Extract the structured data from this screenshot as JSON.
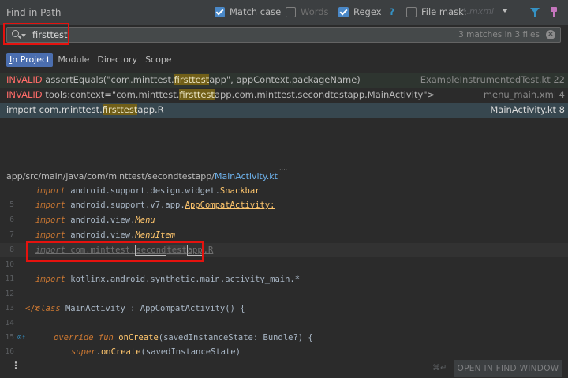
{
  "header": {
    "title": "Find in Path",
    "options": {
      "match_case": {
        "label": "Match case",
        "checked": true
      },
      "words": {
        "label": "Words",
        "checked": false
      },
      "regex": {
        "label": "Regex",
        "help": "?",
        "checked": true
      },
      "file_mask": {
        "label": "File mask:",
        "checked": false,
        "placeholder": "*.mxml"
      }
    }
  },
  "search": {
    "query": "firsttest",
    "match_count": "3 matches in 3 files",
    "clear": "×"
  },
  "scopes": [
    {
      "label": "In Project",
      "active": true
    },
    {
      "label": "Module",
      "active": false
    },
    {
      "label": "Directory",
      "active": false
    },
    {
      "label": "Scope",
      "active": false
    }
  ],
  "results": [
    {
      "prefix": "INVALID",
      "before": " assertEquals(\"com.minttest.",
      "match": "firsttest",
      "after": "app\", appContext.packageName)",
      "file": "ExampleInstrumentedTest.kt 22"
    },
    {
      "prefix": "INVALID",
      "before": " tools:context=\"com.minttest.",
      "match": "firsttest",
      "after": "app.com.minttest.secondtestapp.MainActivity\">",
      "file": "menu_main.xml 4"
    },
    {
      "prefix": "",
      "before": "import com.minttest.",
      "match": "firsttest",
      "after": "app.R",
      "file": "MainActivity.kt 8"
    }
  ],
  "splitter": "....",
  "preview": {
    "path": "app/src/main/java/com/minttest/secondtestapp/",
    "file": "MainActivity.kt",
    "lines": [
      {
        "num": "",
        "kw": "import",
        "rest": " android.support.design.widget.",
        "cls": "Snackbar"
      },
      {
        "num": "5",
        "kw": "import",
        "rest": " android.support.v7.app.",
        "cls": "AppCompatActivity;"
      },
      {
        "num": "6",
        "kw": "import",
        "rest": " android.view.",
        "cls": "Menu"
      },
      {
        "num": "7",
        "kw": "import",
        "rest": " android.view.",
        "cls": "MenuItem"
      },
      {
        "num": "8",
        "kw": "import",
        "rest": " com.minttest.",
        "occ1": "second",
        "occ2": "test",
        "tail": "app",
        "end": ".R"
      },
      {
        "num": "10",
        "text": ""
      },
      {
        "num": "11",
        "kw": "import",
        "rest": " kotlinx.android.synthetic.main.activity_main.*"
      },
      {
        "num": "12",
        "text": ""
      },
      {
        "num": "13",
        "kw": "class",
        "rest": " ",
        "cls": "MainActivity",
        "rest2": " : ",
        "cls2": "AppCompatActivity",
        "rest3": "() {"
      },
      {
        "num": "14",
        "text": ""
      },
      {
        "num": "15",
        "kw": "override fun",
        "rest": " ",
        "cls": "onCreate",
        "rest2": "(savedInstanceState: ",
        "cls2": "Bundle",
        "rest3": "?) {"
      },
      {
        "num": "16",
        "kw": "super",
        "rest": ".",
        "cls": "onCreate",
        "rest2": "(savedInstanceState)"
      }
    ]
  },
  "bottom": {
    "shortcut": "⌘↵",
    "open_button": "OPEN IN FIND WINDOW"
  },
  "colors": {
    "accent": "#4a88c7",
    "invalid": "#ff6b68",
    "match_highlight": "#715f18",
    "annotation_box": "#e5120e"
  }
}
